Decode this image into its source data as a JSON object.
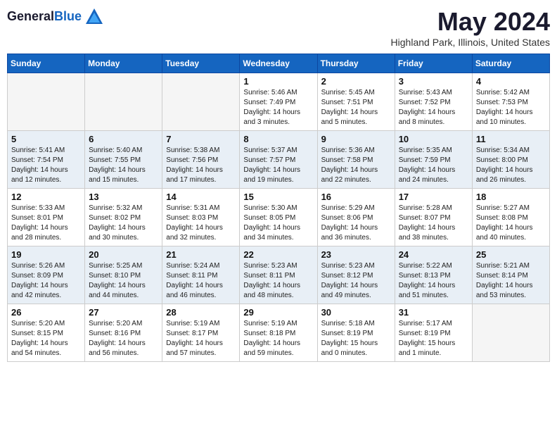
{
  "header": {
    "logo_general": "General",
    "logo_blue": "Blue",
    "month_title": "May 2024",
    "location": "Highland Park, Illinois, United States"
  },
  "days_of_week": [
    "Sunday",
    "Monday",
    "Tuesday",
    "Wednesday",
    "Thursday",
    "Friday",
    "Saturday"
  ],
  "weeks": [
    {
      "week": 1,
      "days": [
        {
          "num": "",
          "info": ""
        },
        {
          "num": "",
          "info": ""
        },
        {
          "num": "",
          "info": ""
        },
        {
          "num": "1",
          "info": "Sunrise: 5:46 AM\nSunset: 7:49 PM\nDaylight: 14 hours\nand 3 minutes."
        },
        {
          "num": "2",
          "info": "Sunrise: 5:45 AM\nSunset: 7:51 PM\nDaylight: 14 hours\nand 5 minutes."
        },
        {
          "num": "3",
          "info": "Sunrise: 5:43 AM\nSunset: 7:52 PM\nDaylight: 14 hours\nand 8 minutes."
        },
        {
          "num": "4",
          "info": "Sunrise: 5:42 AM\nSunset: 7:53 PM\nDaylight: 14 hours\nand 10 minutes."
        }
      ]
    },
    {
      "week": 2,
      "days": [
        {
          "num": "5",
          "info": "Sunrise: 5:41 AM\nSunset: 7:54 PM\nDaylight: 14 hours\nand 12 minutes."
        },
        {
          "num": "6",
          "info": "Sunrise: 5:40 AM\nSunset: 7:55 PM\nDaylight: 14 hours\nand 15 minutes."
        },
        {
          "num": "7",
          "info": "Sunrise: 5:38 AM\nSunset: 7:56 PM\nDaylight: 14 hours\nand 17 minutes."
        },
        {
          "num": "8",
          "info": "Sunrise: 5:37 AM\nSunset: 7:57 PM\nDaylight: 14 hours\nand 19 minutes."
        },
        {
          "num": "9",
          "info": "Sunrise: 5:36 AM\nSunset: 7:58 PM\nDaylight: 14 hours\nand 22 minutes."
        },
        {
          "num": "10",
          "info": "Sunrise: 5:35 AM\nSunset: 7:59 PM\nDaylight: 14 hours\nand 24 minutes."
        },
        {
          "num": "11",
          "info": "Sunrise: 5:34 AM\nSunset: 8:00 PM\nDaylight: 14 hours\nand 26 minutes."
        }
      ]
    },
    {
      "week": 3,
      "days": [
        {
          "num": "12",
          "info": "Sunrise: 5:33 AM\nSunset: 8:01 PM\nDaylight: 14 hours\nand 28 minutes."
        },
        {
          "num": "13",
          "info": "Sunrise: 5:32 AM\nSunset: 8:02 PM\nDaylight: 14 hours\nand 30 minutes."
        },
        {
          "num": "14",
          "info": "Sunrise: 5:31 AM\nSunset: 8:03 PM\nDaylight: 14 hours\nand 32 minutes."
        },
        {
          "num": "15",
          "info": "Sunrise: 5:30 AM\nSunset: 8:05 PM\nDaylight: 14 hours\nand 34 minutes."
        },
        {
          "num": "16",
          "info": "Sunrise: 5:29 AM\nSunset: 8:06 PM\nDaylight: 14 hours\nand 36 minutes."
        },
        {
          "num": "17",
          "info": "Sunrise: 5:28 AM\nSunset: 8:07 PM\nDaylight: 14 hours\nand 38 minutes."
        },
        {
          "num": "18",
          "info": "Sunrise: 5:27 AM\nSunset: 8:08 PM\nDaylight: 14 hours\nand 40 minutes."
        }
      ]
    },
    {
      "week": 4,
      "days": [
        {
          "num": "19",
          "info": "Sunrise: 5:26 AM\nSunset: 8:09 PM\nDaylight: 14 hours\nand 42 minutes."
        },
        {
          "num": "20",
          "info": "Sunrise: 5:25 AM\nSunset: 8:10 PM\nDaylight: 14 hours\nand 44 minutes."
        },
        {
          "num": "21",
          "info": "Sunrise: 5:24 AM\nSunset: 8:11 PM\nDaylight: 14 hours\nand 46 minutes."
        },
        {
          "num": "22",
          "info": "Sunrise: 5:23 AM\nSunset: 8:11 PM\nDaylight: 14 hours\nand 48 minutes."
        },
        {
          "num": "23",
          "info": "Sunrise: 5:23 AM\nSunset: 8:12 PM\nDaylight: 14 hours\nand 49 minutes."
        },
        {
          "num": "24",
          "info": "Sunrise: 5:22 AM\nSunset: 8:13 PM\nDaylight: 14 hours\nand 51 minutes."
        },
        {
          "num": "25",
          "info": "Sunrise: 5:21 AM\nSunset: 8:14 PM\nDaylight: 14 hours\nand 53 minutes."
        }
      ]
    },
    {
      "week": 5,
      "days": [
        {
          "num": "26",
          "info": "Sunrise: 5:20 AM\nSunset: 8:15 PM\nDaylight: 14 hours\nand 54 minutes."
        },
        {
          "num": "27",
          "info": "Sunrise: 5:20 AM\nSunset: 8:16 PM\nDaylight: 14 hours\nand 56 minutes."
        },
        {
          "num": "28",
          "info": "Sunrise: 5:19 AM\nSunset: 8:17 PM\nDaylight: 14 hours\nand 57 minutes."
        },
        {
          "num": "29",
          "info": "Sunrise: 5:19 AM\nSunset: 8:18 PM\nDaylight: 14 hours\nand 59 minutes."
        },
        {
          "num": "30",
          "info": "Sunrise: 5:18 AM\nSunset: 8:19 PM\nDaylight: 15 hours\nand 0 minutes."
        },
        {
          "num": "31",
          "info": "Sunrise: 5:17 AM\nSunset: 8:19 PM\nDaylight: 15 hours\nand 1 minute."
        },
        {
          "num": "",
          "info": ""
        }
      ]
    }
  ]
}
